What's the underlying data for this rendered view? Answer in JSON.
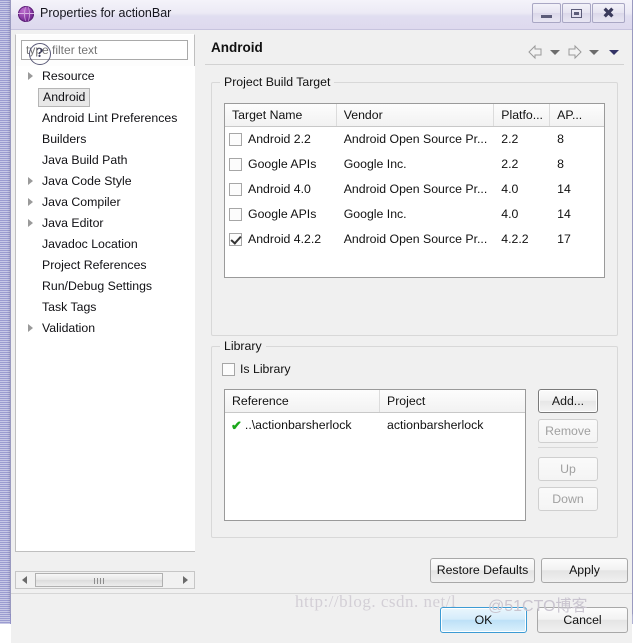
{
  "window": {
    "title": "Properties for actionBar",
    "icon": "eclipse-sphere-icon",
    "controls": {
      "minimize": "minimize-icon",
      "maximize": "maximize-icon",
      "close": "close-icon"
    }
  },
  "sidebar": {
    "filter": {
      "placeholder": "type filter text",
      "value": ""
    },
    "items": [
      {
        "label": "Resource",
        "expandable": true,
        "selected": false
      },
      {
        "label": "Android",
        "expandable": false,
        "selected": true
      },
      {
        "label": "Android Lint Preferences",
        "expandable": false,
        "selected": false
      },
      {
        "label": "Builders",
        "expandable": false,
        "selected": false
      },
      {
        "label": "Java Build Path",
        "expandable": false,
        "selected": false
      },
      {
        "label": "Java Code Style",
        "expandable": true,
        "selected": false
      },
      {
        "label": "Java Compiler",
        "expandable": true,
        "selected": false
      },
      {
        "label": "Java Editor",
        "expandable": true,
        "selected": false
      },
      {
        "label": "Javadoc Location",
        "expandable": false,
        "selected": false
      },
      {
        "label": "Project References",
        "expandable": false,
        "selected": false
      },
      {
        "label": "Run/Debug Settings",
        "expandable": false,
        "selected": false
      },
      {
        "label": "Task Tags",
        "expandable": false,
        "selected": false
      },
      {
        "label": "Validation",
        "expandable": true,
        "selected": false
      }
    ]
  },
  "content": {
    "title": "Android",
    "nav": {
      "back": "back-arrow-icon",
      "back_menu": "chevron-down-icon",
      "forward": "forward-arrow-icon",
      "forward_menu": "chevron-down-icon",
      "view_menu": "view-menu-icon"
    },
    "build_target": {
      "group_label": "Project Build Target",
      "columns": [
        "Target Name",
        "Vendor",
        "Platfo...",
        "AP..."
      ],
      "rows": [
        {
          "checked": false,
          "name": "Android 2.2",
          "vendor": "Android Open Source Pr...",
          "platform": "2.2",
          "api": "8"
        },
        {
          "checked": false,
          "name": "Google APIs",
          "vendor": "Google Inc.",
          "platform": "2.2",
          "api": "8"
        },
        {
          "checked": false,
          "name": "Android 4.0",
          "vendor": "Android Open Source Pr...",
          "platform": "4.0",
          "api": "14"
        },
        {
          "checked": false,
          "name": "Google APIs",
          "vendor": "Google Inc.",
          "platform": "4.0",
          "api": "14"
        },
        {
          "checked": true,
          "name": "Android 4.2.2",
          "vendor": "Android Open Source Pr...",
          "platform": "4.2.2",
          "api": "17"
        }
      ]
    },
    "library": {
      "group_label": "Library",
      "is_library": {
        "label": "Is Library",
        "checked": false
      },
      "columns": [
        "Reference",
        "Project"
      ],
      "rows": [
        {
          "status": "check-green-icon",
          "reference": "..\\actionbarsherlock",
          "project": "actionbarsherlock"
        }
      ],
      "buttons": [
        {
          "label": "Add...",
          "enabled": true
        },
        {
          "label": "Remove",
          "enabled": false
        },
        {
          "label": "Up",
          "enabled": false
        },
        {
          "label": "Down",
          "enabled": false
        }
      ]
    },
    "restore_defaults_label": "Restore Defaults",
    "apply_label": "Apply"
  },
  "footer": {
    "help_icon": "help-question-icon",
    "ok_label": "OK",
    "cancel_label": "Cancel"
  },
  "watermark": {
    "url": "http://blog. csdn. net/l",
    "tag": "@51CTO博客"
  },
  "scrollbar": {
    "left_arrow": "scroll-left-icon",
    "right_arrow": "scroll-right-icon"
  },
  "colors": {
    "accent": "#3c9bd4",
    "titlebar": "#e6e4f2",
    "dialog_bg": "#f0f0f0",
    "check_green": "#1aa81a"
  }
}
